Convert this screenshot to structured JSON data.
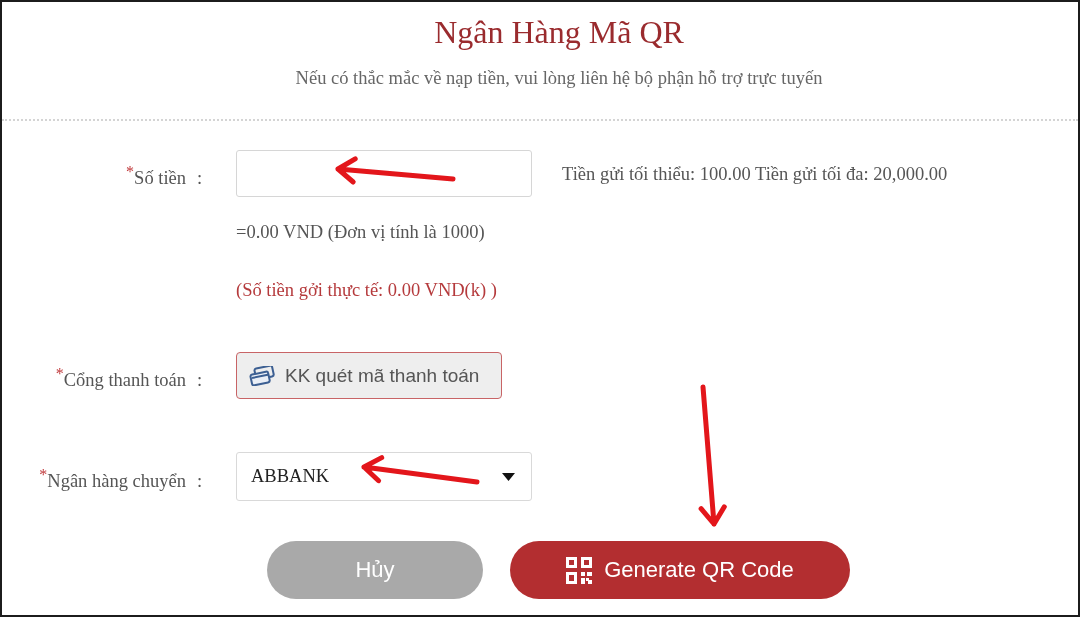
{
  "header": {
    "title": "Ngân Hàng Mã QR",
    "subtitle": "Nếu có thắc mắc về nạp tiền, vui lòng liên hệ bộ phận hỗ trợ trực tuyến"
  },
  "form": {
    "fields": [
      {
        "kind": "input",
        "label": "$^{*}$Số tiền",
        "separator": ":",
        "hint": "Tiền gửi tối thiểu: 100.00 Tiền gửi tối đa: 20,000.00",
        "notes": [
          {
            "kind": "plain",
            "text": "=0.00 VND (Đơn vị tính là 1000)"
          },
          {
            "kind": "warning",
            "text": "(Số tiền gởi thực tế: 0.00 VND(k) )"
          }
        ]
      },
      {
        "kind": "option",
        "label": "$^{*}$Cổng thanh toán",
        "separator": ":",
        "options": [
          {
            "label": "KK quét mã thanh toán",
            "selected": true
          }
        ]
      },
      {
        "kind": "select",
        "label": "$^{*}$Ngân hàng chuyển",
        "separator": ":",
        "value": "ABBANK"
      }
    ]
  },
  "actions": [
    {
      "kind": "secondary",
      "label": "Hủy"
    },
    {
      "kind": "primary",
      "label": "Generate QR Code"
    }
  ]
}
